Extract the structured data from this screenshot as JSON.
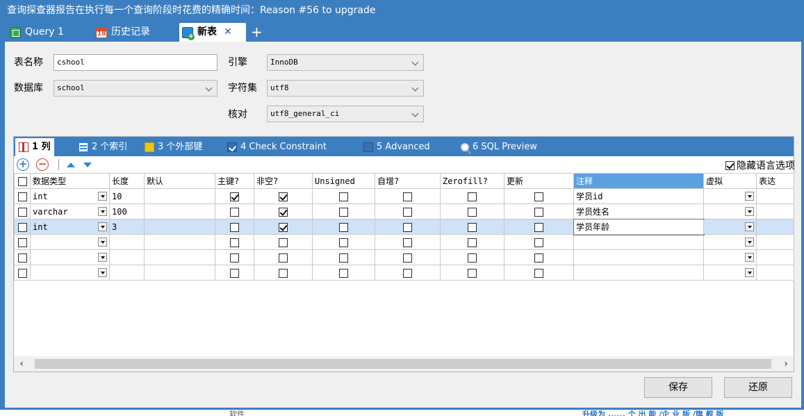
{
  "window": {
    "title": "查询探查器报告在执行每一个查询阶段时花费的精确时间：Reason #56 to upgrade"
  },
  "tabs": [
    {
      "label": "Query 1"
    },
    {
      "label": "历史记录"
    },
    {
      "label": "新表"
    }
  ],
  "form": {
    "table_name_label": "表名称",
    "table_name_value": "cshool",
    "database_label": "数据库",
    "database_value": "school",
    "engine_label": "引擎",
    "engine_value": "InnoDB",
    "charset_label": "字符集",
    "charset_value": "utf8",
    "collation_label": "核对",
    "collation_value": "utf8_general_ci"
  },
  "subtabs": [
    {
      "label": "1 列"
    },
    {
      "label": "2 个索引"
    },
    {
      "label": "3 个外部键"
    },
    {
      "label": "4 Check Constraint"
    },
    {
      "label": "5 Advanced"
    },
    {
      "label": "6 SQL Preview"
    }
  ],
  "toolbar": {
    "hide_lang_label": "隐藏语言选项"
  },
  "grid": {
    "headers": {
      "datatype": "数据类型",
      "length": "长度",
      "default": "默认",
      "pk": "主键?",
      "notnull": "非空?",
      "unsigned": "Unsigned",
      "autoinc": "自增?",
      "zerofill": "Zerofill?",
      "update": "更新",
      "comment": "注释",
      "virtual": "虚拟",
      "expr": "表达"
    },
    "rows": [
      {
        "datatype": "int",
        "length": "10",
        "default": "",
        "pk": true,
        "notnull": true,
        "unsigned": false,
        "autoinc": false,
        "zerofill": false,
        "update": false,
        "comment": "学员id"
      },
      {
        "datatype": "varchar",
        "length": "100",
        "default": "",
        "pk": false,
        "notnull": true,
        "unsigned": false,
        "autoinc": false,
        "zerofill": false,
        "update": false,
        "comment": "学员姓名"
      },
      {
        "datatype": "int",
        "length": "3",
        "default": "",
        "pk": false,
        "notnull": true,
        "unsigned": false,
        "autoinc": false,
        "zerofill": false,
        "update": false,
        "comment": "学员年龄"
      },
      {
        "datatype": "",
        "length": "",
        "default": "",
        "pk": false,
        "notnull": false,
        "unsigned": false,
        "autoinc": false,
        "zerofill": false,
        "update": false,
        "comment": ""
      },
      {
        "datatype": "",
        "length": "",
        "default": "",
        "pk": false,
        "notnull": false,
        "unsigned": false,
        "autoinc": false,
        "zerofill": false,
        "update": false,
        "comment": ""
      },
      {
        "datatype": "",
        "length": "",
        "default": "",
        "pk": false,
        "notnull": false,
        "unsigned": false,
        "autoinc": false,
        "zerofill": false,
        "update": false,
        "comment": ""
      }
    ],
    "selected_row": 2
  },
  "buttons": {
    "save": "保存",
    "revert": "还原"
  },
  "footer": {
    "left_text": "软件",
    "right_text": "升级为 ...... 个 出 能 /企 业 版 /旗 舰 版"
  },
  "colors": {
    "accent": "#3c7fc1",
    "highlight_header": "#5aa0e0",
    "selected_row": "#cfe2f7"
  }
}
